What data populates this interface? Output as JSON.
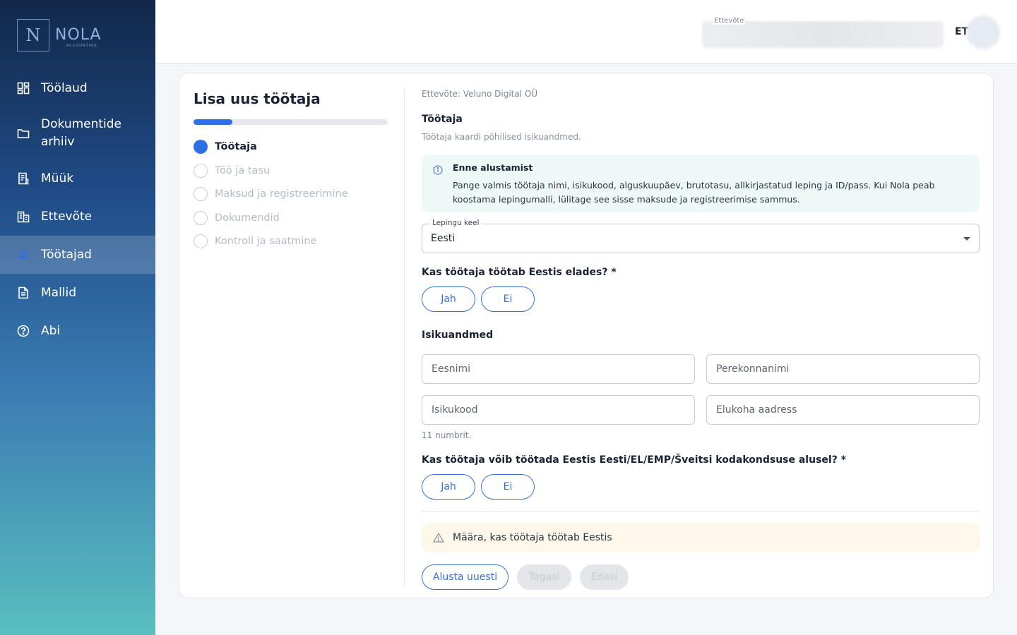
{
  "brand": {
    "logo_letter": "N",
    "name": "NOLA",
    "sub": "ACCOUNTING"
  },
  "sidebar": {
    "items": [
      {
        "label": "Töölaud",
        "icon": "dashboard-icon"
      },
      {
        "label": "Dokumentide arhiiv",
        "icon": "folder-icon"
      },
      {
        "label": "Müük",
        "icon": "receipt-icon"
      },
      {
        "label": "Ettevõte",
        "icon": "building-icon"
      },
      {
        "label": "Töötajad",
        "icon": "people-icon",
        "active": true
      },
      {
        "label": "Mallid",
        "icon": "document-icon"
      },
      {
        "label": "Abi",
        "icon": "help-icon"
      }
    ]
  },
  "header": {
    "company_label": "Ettevõte",
    "language": "ET"
  },
  "wizard": {
    "title": "Lisa uus töötaja",
    "progress_fraction": 0.2,
    "steps": [
      {
        "label": "Töötaja",
        "active": true
      },
      {
        "label": "Töö ja tasu"
      },
      {
        "label": "Maksud ja registreerimine"
      },
      {
        "label": "Dokumendid"
      },
      {
        "label": "Kontroll ja saatmine"
      }
    ]
  },
  "form": {
    "company_line": "Ettevõte: Veluno Digital OÜ",
    "section_title": "Töötaja",
    "section_subtitle": "Töötaja kaardi põhilised isikuandmed.",
    "info": {
      "title": "Enne alustamist",
      "text": "Pange valmis töötaja nimi, isikukood, alguskuupäev, brutotasu, allkirjastatud leping ja ID/pass. Kui Nola peab koostama lepingumalli, lülitage see sisse maksude ja registreerimise sammus."
    },
    "contract_language": {
      "label": "Lepingu keel",
      "value": "Eesti"
    },
    "q_works_in_estonia": "Kas töötaja töötab Eestis elades? *",
    "yes": "Jah",
    "no": "Ei",
    "personal_title": "Isikuandmed",
    "fields": {
      "first_name": "Eesnimi",
      "last_name": "Perekonnanimi",
      "id_code": "Isikukood",
      "address": "Elukoha aadress"
    },
    "id_helper": "11 numbrit.",
    "q_citizenship": "Kas töötaja võib töötada Eestis Eesti/EL/EMP/Šveitsi kodakondsuse alusel? *",
    "warning": "Määra, kas töötaja töötab Eestis",
    "buttons": {
      "restart": "Alusta uuesti",
      "back": "Tagasi",
      "next": "Edasi"
    }
  },
  "colors": {
    "accent": "#2f6fe4",
    "outline": "#3a6fd8",
    "info_bg": "#eef8f7",
    "warn_bg": "#fef8ea"
  }
}
